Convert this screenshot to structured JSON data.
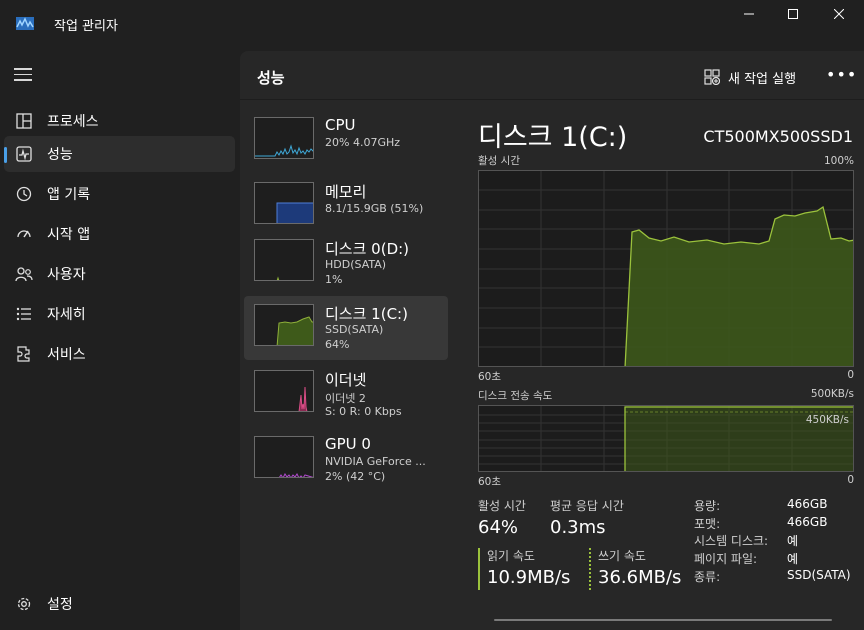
{
  "window": {
    "title": "작업 관리자"
  },
  "sidebar": {
    "items": [
      {
        "label": "프로세스",
        "icon": "processes-icon"
      },
      {
        "label": "성능",
        "icon": "performance-icon",
        "active": true
      },
      {
        "label": "앱 기록",
        "icon": "history-icon"
      },
      {
        "label": "시작 앱",
        "icon": "startup-icon"
      },
      {
        "label": "사용자",
        "icon": "users-icon"
      },
      {
        "label": "자세히",
        "icon": "details-icon"
      },
      {
        "label": "서비스",
        "icon": "services-icon"
      }
    ],
    "settings_label": "설정"
  },
  "main": {
    "title": "성능",
    "run_task_label": "새 작업 실행",
    "more_label": "•••"
  },
  "devices": [
    {
      "name": "CPU",
      "line1": "20% 4.07GHz",
      "line2": "",
      "color": "#3fa9d8"
    },
    {
      "name": "메모리",
      "line1": "8.1/15.9GB (51%)",
      "line2": "",
      "color": "#4f7fd8"
    },
    {
      "name": "디스크 0(D:)",
      "line1": "HDD(SATA)",
      "line2": "1%",
      "color": "#8fb03a"
    },
    {
      "name": "디스크 1(C:)",
      "line1": "SSD(SATA)",
      "line2": "64%",
      "color": "#8fb03a"
    },
    {
      "name": "이더넷",
      "line1": "이더넷 2",
      "line2": "S: 0 R: 0 Kbps",
      "color": "#d94d86"
    },
    {
      "name": "GPU 0",
      "line1": "NVIDIA GeForce ...",
      "line2": "2% (42 °C)",
      "color": "#b24bd0"
    }
  ],
  "detail": {
    "title": "디스크 1(C:)",
    "model": "CT500MX500SSD1",
    "active_time_label": "활성 시간",
    "active_time_max": "100%",
    "time_left": "60초",
    "time_right": "0",
    "transfer_label": "디스크 전송 속도",
    "transfer_max": "500KB/s",
    "transfer_mark": "450KB/s",
    "graph_color": "#9bc23c",
    "stats": {
      "active_label": "활성 시간",
      "active_value": "64%",
      "response_label": "평균 응답 시간",
      "response_value": "0.3ms",
      "read_label": "읽기 속도",
      "read_value": "10.9MB/s",
      "write_label": "쓰기 속도",
      "write_value": "36.6MB/s"
    },
    "props": [
      {
        "key": "용량:",
        "value": "466GB"
      },
      {
        "key": "포맷:",
        "value": "466GB"
      },
      {
        "key": "시스템 디스크:",
        "value": "예"
      },
      {
        "key": "페이지 파일:",
        "value": "예"
      },
      {
        "key": "종류:",
        "value": "SSD(SATA)"
      }
    ]
  }
}
